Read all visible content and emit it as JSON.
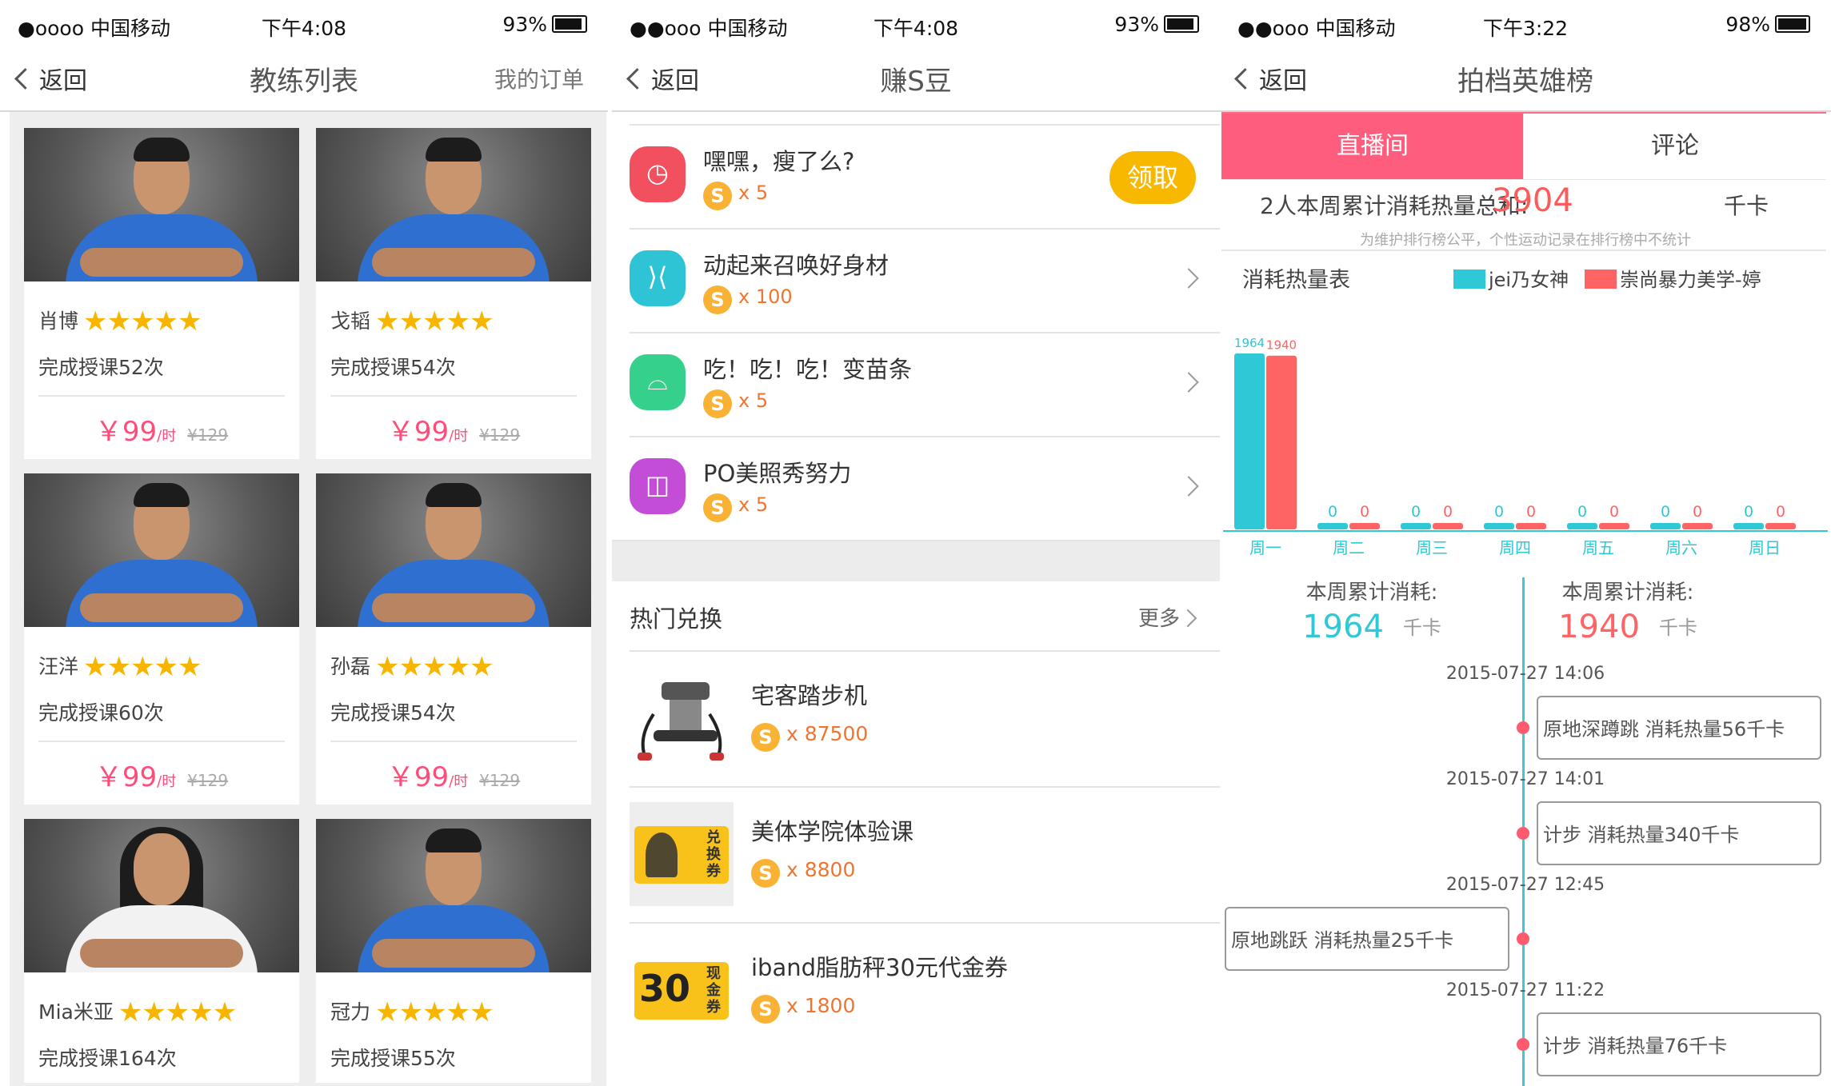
{
  "status_left": {
    "carrier_a": "●oooo 中国移动",
    "carrier_b": "●●ooo 中国移动",
    "carrier_c": "●●ooo 中国移动"
  },
  "status": [
    {
      "time": "下午4:08",
      "battery": "93%",
      "level": 0.93
    },
    {
      "time": "下午4:08",
      "battery": "93%",
      "level": 0.93
    },
    {
      "time": "下午3:22",
      "battery": "98%",
      "level": 0.98
    }
  ],
  "back_label": "返回",
  "coaches_screen": {
    "title": "教练列表",
    "right_action": "我的订单",
    "stars": "★★★★★",
    "currency": "￥",
    "per_hour": "/时",
    "coaches": [
      {
        "name": "肖博",
        "lessons": "完成授课52次",
        "price": "99",
        "orig": "¥129",
        "gender": "m"
      },
      {
        "name": "戈韬",
        "lessons": "完成授课54次",
        "price": "99",
        "orig": "¥129",
        "gender": "m"
      },
      {
        "name": "汪洋",
        "lessons": "完成授课60次",
        "price": "99",
        "orig": "¥129",
        "gender": "m"
      },
      {
        "name": "孙磊",
        "lessons": "完成授课54次",
        "price": "99",
        "orig": "¥129",
        "gender": "m"
      },
      {
        "name": "Mia米亚",
        "lessons": "完成授课164次",
        "gender": "f"
      },
      {
        "name": "冠力",
        "lessons": "完成授课55次",
        "gender": "m"
      }
    ]
  },
  "earn_screen": {
    "title": "赚S豆",
    "coin": "S",
    "claim_label": "领取",
    "tasks": [
      {
        "title": "嘿嘿，瘦了么?",
        "reward": "x 5",
        "color": "#f3505f",
        "icon": "scale-icon"
      },
      {
        "title": "动起来召唤好身材",
        "reward": "x 100",
        "color": "#2ec4d6",
        "icon": "body-icon"
      },
      {
        "title": "吃！吃！吃！变苗条",
        "reward": "x 5",
        "color": "#35d08c",
        "icon": "food-icon"
      },
      {
        "title": "PO美照秀努力",
        "reward": "x 5",
        "color": "#c44dd8",
        "icon": "camera-icon"
      }
    ],
    "hot_title": "热门兑换",
    "more_label": "更多",
    "products": [
      {
        "name": "宅客踏步机",
        "price": "x 87500",
        "icon": "stepper-machine-icon"
      },
      {
        "name": "美体学院体验课",
        "price": "x 8800",
        "icon": "exchange-ticket-icon",
        "ticket_text": "兑换券"
      },
      {
        "name": "iband脂肪秤30元代金券",
        "price": "x 1800",
        "icon": "cash-voucher-icon",
        "ticket_big": "30",
        "ticket_text": "现金券"
      }
    ]
  },
  "hero_screen": {
    "title": "拍档英雄榜",
    "tabs": [
      "直播间",
      "评论"
    ],
    "sum_label": "2人本周累计消耗热量总和:",
    "sum_value": "3904",
    "unit": "千卡",
    "notice": "为维护排行榜公平，个性运动记录在排行榜中不统计",
    "chart_title": "消耗热量表",
    "legend": [
      {
        "name": "jei乃女神",
        "color": "#2ec8d6"
      },
      {
        "name": "崇尚暴力美学-婷",
        "color": "#ff6465"
      }
    ],
    "weekly_label": "本周累计消耗:",
    "weekly": [
      {
        "value": "1964",
        "color": "#2ec8d6"
      },
      {
        "value": "1940",
        "color": "#ff6465"
      }
    ],
    "timeline": [
      {
        "time": "2015-07-27 14:06",
        "text": "原地深蹲跳 消耗热量56千卡",
        "side": "right"
      },
      {
        "time": "2015-07-27 14:01",
        "text": "计步 消耗热量340千卡",
        "side": "right"
      },
      {
        "time": "2015-07-27 12:45",
        "text": "原地跳跃 消耗热量25千卡",
        "side": "left"
      },
      {
        "time": "2015-07-27 11:22",
        "text": "计步 消耗热量76千卡",
        "side": "right"
      }
    ]
  },
  "chart_data": {
    "type": "bar",
    "categories": [
      "周一",
      "周二",
      "周三",
      "周四",
      "周五",
      "周六",
      "周日"
    ],
    "series": [
      {
        "name": "jei乃女神",
        "values": [
          1964,
          0,
          0,
          0,
          0,
          0,
          0
        ]
      },
      {
        "name": "崇尚暴力美学-婷",
        "values": [
          1940,
          0,
          0,
          0,
          0,
          0,
          0
        ]
      }
    ],
    "title": "消耗热量表",
    "legend_position": "top-right",
    "grid": false
  }
}
